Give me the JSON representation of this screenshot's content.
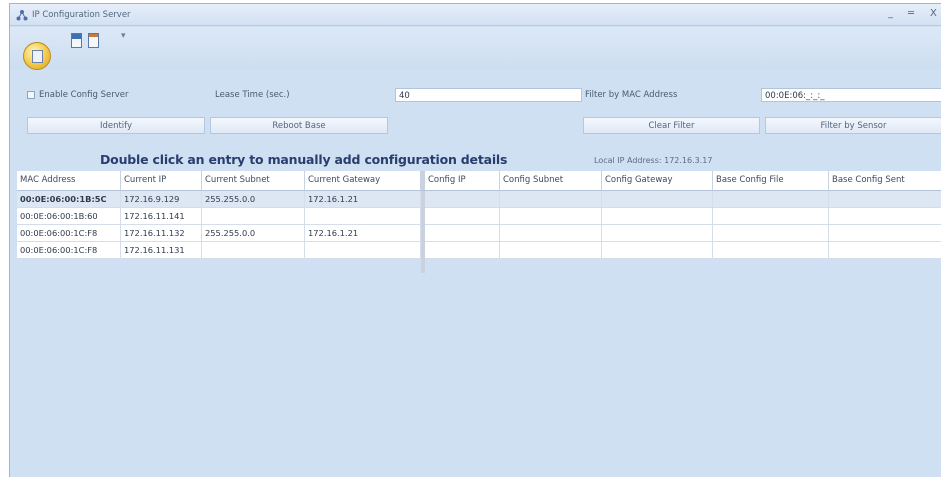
{
  "window": {
    "title": "IP Configuration Server",
    "controls": [
      "_",
      "═",
      "X"
    ]
  },
  "form": {
    "enable_config_server": {
      "label": "Enable Config Server",
      "checked": false
    },
    "lease_time": {
      "label": "Lease Time (sec.)",
      "value": "40"
    },
    "filter_mac": {
      "label": "Filter by MAC Address",
      "value": "00:0E:06:_:_:_"
    }
  },
  "buttons": {
    "identify": "Identify",
    "reboot_base": "Reboot Base",
    "clear_filter": "Clear Filter",
    "filter_by_sensor": "Filter by Sensor"
  },
  "message": "Double click an entry to manually add configuration details",
  "local_ip": "Local IP Address: 172.16.3.17",
  "table": {
    "columns": [
      "MAC Address",
      "Current IP",
      "Current Subnet",
      "Current Gateway",
      "Config IP",
      "Config Subnet",
      "Config Gateway",
      "Base Config File",
      "Base Config Sent"
    ],
    "rows": [
      {
        "mac": "00:0E:06:00:1B:5C",
        "current_ip": "172.16.9.129",
        "current_subnet": "255.255.0.0",
        "current_gateway": "172.16.1.21",
        "config_ip": "",
        "config_subnet": "",
        "config_gateway": "",
        "base_config_file": "",
        "base_config_sent": ""
      },
      {
        "mac": "00:0E:06:00:1B:60",
        "current_ip": "172.16.11.141",
        "current_subnet": "",
        "current_gateway": "",
        "config_ip": "",
        "config_subnet": "",
        "config_gateway": "",
        "base_config_file": "",
        "base_config_sent": ""
      },
      {
        "mac": "00:0E:06:00:1C:F8",
        "current_ip": "172.16.11.132",
        "current_subnet": "255.255.0.0",
        "current_gateway": "172.16.1.21",
        "config_ip": "",
        "config_subnet": "",
        "config_gateway": "",
        "base_config_file": "",
        "base_config_sent": ""
      },
      {
        "mac": "00:0E:06:00:1C:F8",
        "current_ip": "172.16.11.131",
        "current_subnet": "",
        "current_gateway": "",
        "config_ip": "",
        "config_subnet": "",
        "config_gateway": "",
        "base_config_file": "",
        "base_config_sent": ""
      }
    ]
  },
  "colors": {
    "window_background": "#cfe0f3",
    "heading_text": "#2a3d6e",
    "selected_row": "#dde7f4"
  }
}
